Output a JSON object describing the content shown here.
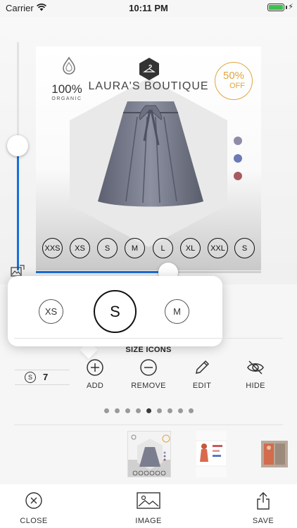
{
  "status": {
    "carrier": "Carrier",
    "time": "10:11 PM"
  },
  "product": {
    "brand": "LAURA'S BOUTIQUE",
    "organic_pct": "100%",
    "organic_word": "ORGANIC",
    "sale_pct": "50%",
    "sale_off": "OFF",
    "sizes": [
      "XXS",
      "XS",
      "S",
      "M",
      "L",
      "XL",
      "XXL",
      "S"
    ],
    "swatches": [
      "#8e8ca6",
      "#6c78b8",
      "#a85a5e"
    ]
  },
  "colors": {
    "accent": "#1a6fd9",
    "sale": "#e0a640"
  },
  "sliders": {
    "vertical_value": 0.57,
    "horizontal_value": 0.59
  },
  "popover": {
    "options": [
      "XS",
      "S",
      "M"
    ],
    "selected": "S"
  },
  "panel": {
    "title": "SIZE ICONS",
    "stepper": {
      "chip": "S",
      "value": "7"
    },
    "actions": [
      {
        "label": "ADD",
        "icon": "plus-circle-icon"
      },
      {
        "label": "REMOVE",
        "icon": "minus-circle-icon"
      },
      {
        "label": "EDIT",
        "icon": "pencil-icon"
      },
      {
        "label": "HIDE",
        "icon": "eye-slash-icon"
      }
    ]
  },
  "pager": {
    "count": 9,
    "active": 5
  },
  "toolbar": {
    "close": "CLOSE",
    "image": "IMAGE",
    "save": "SAVE"
  }
}
